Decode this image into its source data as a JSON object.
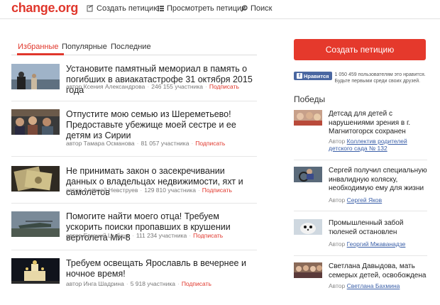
{
  "header": {
    "logo": "change.org",
    "nav": [
      {
        "label": "Создать петицию",
        "icon": "pencil-icon"
      },
      {
        "label": "Просмотреть петиции",
        "icon": "list-icon"
      },
      {
        "label": "Поиск",
        "icon": "search-icon"
      }
    ]
  },
  "tabs": [
    {
      "label": "Избранные",
      "active": true
    },
    {
      "label": "Популярные",
      "active": false
    },
    {
      "label": "Последние",
      "active": false
    }
  ],
  "petitions": [
    {
      "title": "Установите памятный мемориал в память о погибших в авиакатастрофе 31 октября 2015 года",
      "author": "автор Ксения Александрова",
      "count": "246 155 участника",
      "sign": "Подписать"
    },
    {
      "title": "Отпустите мою семью из Шереметьево! Предоставьте убежище моей сестре и ее детям из Сирии",
      "author": "автор Тамара Османова",
      "count": "81 057 участника",
      "sign": "Подписать"
    },
    {
      "title": "Не принимать закон о засекречивании данных о владельцах недвижимости, яхт и самолётов",
      "author": "автор Алексей Невструев",
      "count": "129 810 участника",
      "sign": "Подписать"
    },
    {
      "title": "Помогите найти моего отца! Требуем ускорить поиски пропавших в крушении вертолета Ми-8",
      "author": "автор Евгений Цыбань",
      "count": "111 234 участника",
      "sign": "Подписать"
    },
    {
      "title": "Требуем освещать Ярославль в вечернее и ночное время!",
      "author": "автор Инга Шадрина",
      "count": "5 918 участника",
      "sign": "Подписать"
    }
  ],
  "sidebar": {
    "create_button": "Создать петицию",
    "fb_like": "Нравится",
    "fb_text_1": "1 050 459 пользователям это нравится.",
    "fb_text_2": "Будьте первыми среди своих друзей.",
    "wins_title": "Победы",
    "wins": [
      {
        "title": "Детсад для детей с нарушениями зрения в г. Магнитогорск сохранен",
        "author_prefix": "Автор",
        "author": "Коллектив родителей детского сада № 132"
      },
      {
        "title": "Сергей получил специальную инвалидную коляску, необходимую ему для жизни",
        "author_prefix": "Автор",
        "author": "Сергей Яков"
      },
      {
        "title": "Промышленный забой тюленей остановлен",
        "author_prefix": "Автор",
        "author": "Георгий Мжаванадзе"
      },
      {
        "title": "Светлана Давыдова, мать семерых детей, освобождена",
        "author_prefix": "Автор",
        "author": "Светлана Бахмина"
      }
    ]
  },
  "colors": {
    "accent": "#e0372c",
    "link": "#3a5fa8",
    "facebook": "#4a67a1"
  }
}
